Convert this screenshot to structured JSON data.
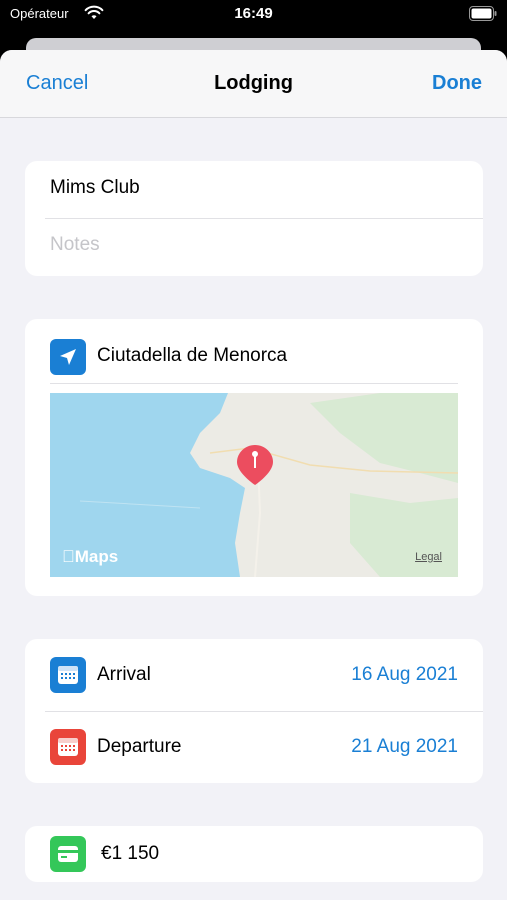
{
  "status_bar": {
    "carrier": "Opérateur",
    "time": "16:49"
  },
  "nav": {
    "cancel": "Cancel",
    "title": "Lodging",
    "done": "Done"
  },
  "lodging": {
    "name": "Mims Club",
    "notes_placeholder": "Notes"
  },
  "location": {
    "name": "Ciutadella de Menorca",
    "icon": "location-arrow-icon",
    "map_brand": "Maps",
    "map_legal": "Legal"
  },
  "dates": {
    "arrival": {
      "label": "Arrival",
      "value": "16 Aug 2021",
      "icon": "calendar-icon",
      "color": "#1a7fd4"
    },
    "departure": {
      "label": "Departure",
      "value": "21 Aug 2021",
      "icon": "calendar-icon",
      "color": "#e9453a"
    }
  },
  "price": {
    "value": "€1 150",
    "icon": "credit-card-icon",
    "color": "#34c759"
  },
  "colors": {
    "accent": "#1a7fd4",
    "background": "#f2f2f7"
  }
}
